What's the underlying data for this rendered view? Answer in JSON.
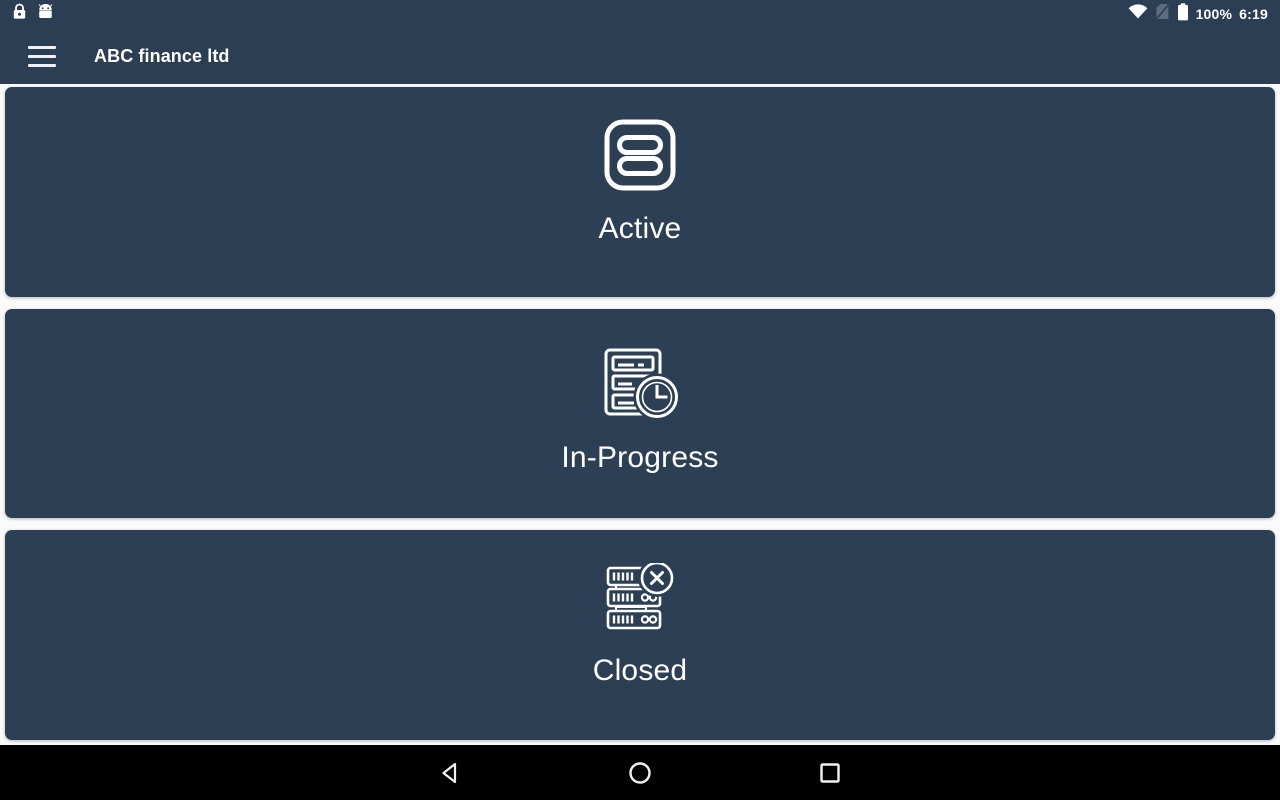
{
  "status_bar": {
    "left_icons": [
      {
        "name": "lock-icon",
        "label": "lock"
      },
      {
        "name": "android-robot-icon",
        "label": "android"
      }
    ],
    "right_icons": [
      {
        "name": "wifi-icon",
        "label": "wifi"
      },
      {
        "name": "no-sim-icon",
        "label": "no-signal"
      },
      {
        "name": "battery-icon",
        "label": "battery"
      }
    ],
    "battery_percent": "100%",
    "time": "6:19"
  },
  "app_bar": {
    "menu_icon": "hamburger-menu-icon",
    "title": "ABC finance ltd"
  },
  "main": {
    "cards": [
      {
        "id": "active",
        "label": "Active",
        "icon": "list-rows-icon"
      },
      {
        "id": "in-progress",
        "label": "In-Progress",
        "icon": "document-clock-icon"
      },
      {
        "id": "closed",
        "label": "Closed",
        "icon": "server-close-icon"
      }
    ]
  },
  "nav_bar": {
    "back": "back-triangle",
    "home": "home-circle",
    "recents": "recents-square"
  },
  "colors": {
    "card_background": "#2c3f55",
    "app_bar_background": "#2b3e54",
    "page_background": "#fafafa",
    "nav_bar_background": "#000000",
    "text_on_dark": "#ffffff"
  }
}
